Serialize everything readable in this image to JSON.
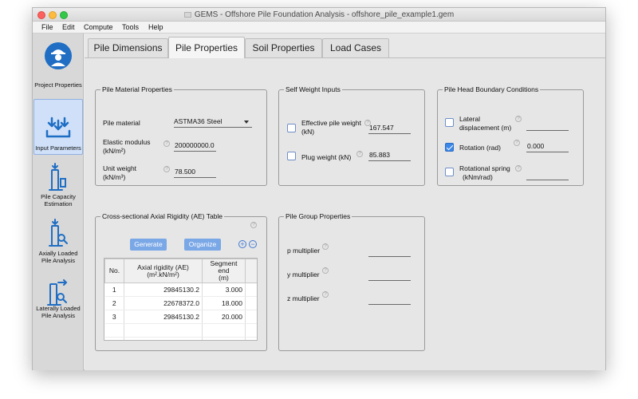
{
  "window": {
    "title": "GEMS - Offshore Pile Foundation Analysis - offshore_pile_example1.gem"
  },
  "menu": [
    "File",
    "Edit",
    "Compute",
    "Tools",
    "Help"
  ],
  "sidebar": {
    "items": [
      {
        "label": "Project Properties",
        "icon": "engineer-icon"
      },
      {
        "label": "Input Parameters",
        "icon": "input-arrows-icon"
      },
      {
        "label": "Pile Capacity Estimation",
        "icon": "pile-capacity-icon"
      },
      {
        "label": "Axially Loaded Pile Analysis",
        "icon": "axial-pile-icon"
      },
      {
        "label": "Laterally Loaded Pile Analysis",
        "icon": "lateral-pile-icon"
      }
    ],
    "active": "Input Parameters"
  },
  "tabs": [
    {
      "label": "Pile Dimensions"
    },
    {
      "label": "Pile Properties"
    },
    {
      "label": "Soil Properties"
    },
    {
      "label": "Load Cases"
    }
  ],
  "active_tab": "Pile Properties",
  "material": {
    "legend": "Pile Material Properties",
    "material_label": "Pile material",
    "material_value": "ASTMA36 Steel",
    "elastic_label_1": "Elastic modulus",
    "elastic_label_2": "(kN/m²)",
    "elastic_value": "200000000.0",
    "unit_weight_label_1": "Unit weight",
    "unit_weight_label_2": "(kN/m³)",
    "unit_weight_value": "78.500"
  },
  "self_weight": {
    "legend": "Self Weight Inputs",
    "effective_label_1": "Effective pile weight",
    "effective_label_2": "(kN)",
    "effective_value": "167.547",
    "effective_checked": false,
    "plug_label": "Plug weight (kN)",
    "plug_value": "85.883",
    "plug_checked": false
  },
  "boundary": {
    "legend": "Pile Head Boundary Conditions",
    "lateral_label_1": "Lateral",
    "lateral_label_2": "displacement (m)",
    "lateral_value": "",
    "lateral_checked": false,
    "rotation_label": "Rotation (rad)",
    "rotation_value": "0.000",
    "rotation_checked": true,
    "spring_label_1": "Rotational spring",
    "spring_label_2": "(kNm/rad)",
    "spring_value": "",
    "spring_checked": false
  },
  "ae_table": {
    "legend": "Cross-sectional Axial Rigidity (AE) Table",
    "generate_label": "Generate",
    "organize_label": "Organize",
    "add_symbol": "+",
    "remove_symbol": "−",
    "col_no": "No.",
    "col_ae_1": "Axial rigidity (AE)",
    "col_ae_2": "(m².kN/m²)",
    "col_seg_1": "Segment end",
    "col_seg_2": "(m)",
    "rows": [
      {
        "no": "1",
        "ae": "29845130.2",
        "seg": "3.000"
      },
      {
        "no": "2",
        "ae": "22678372.0",
        "seg": "18.000"
      },
      {
        "no": "3",
        "ae": "29845130.2",
        "seg": "20.000"
      }
    ]
  },
  "group": {
    "legend": "Pile Group Properties",
    "p_label": "p multiplier",
    "y_label": "y multiplier",
    "z_label": "z multiplier",
    "p_value": "",
    "y_value": "",
    "z_value": ""
  },
  "help_symbol": "?",
  "colors": {
    "accent": "#3b87e8",
    "button": "#7aa7e6",
    "active_nav": "#cfe0f8"
  }
}
